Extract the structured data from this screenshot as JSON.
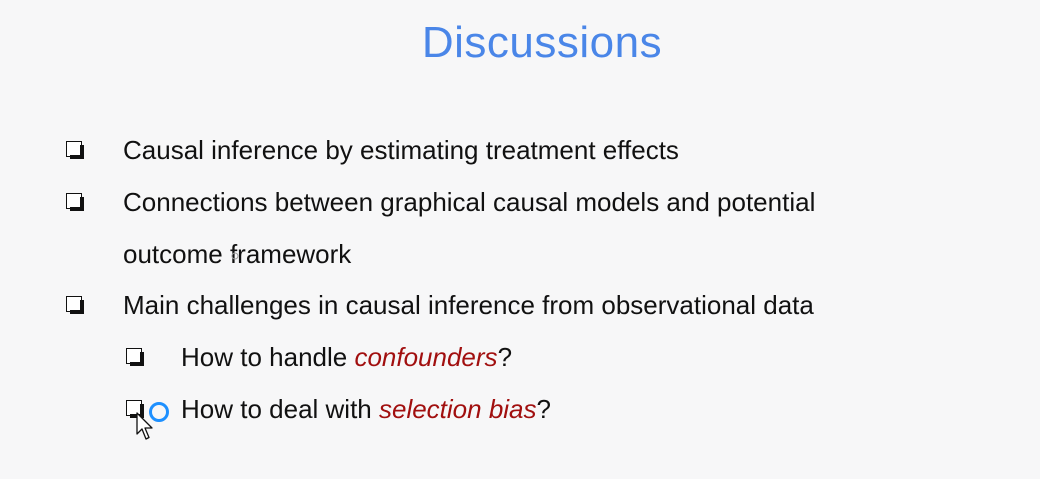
{
  "slide": {
    "title": "Discussions",
    "bullets": [
      {
        "level": 1,
        "parts": [
          {
            "text": "Causal inference by estimating treatment effects",
            "emphasis": false
          }
        ]
      },
      {
        "level": 1,
        "parts": [
          {
            "text": "Connections between graphical causal models and potential",
            "emphasis": false
          },
          {
            "text": "outcome framework",
            "emphasis": false
          }
        ]
      },
      {
        "level": 1,
        "parts": [
          {
            "text": "Main challenges in causal inference from observational data",
            "emphasis": false
          }
        ]
      },
      {
        "level": 2,
        "parts": [
          {
            "text": "How to handle ",
            "emphasis": false
          },
          {
            "text": "confounders",
            "emphasis": true
          },
          {
            "text": "?",
            "emphasis": false
          }
        ]
      },
      {
        "level": 2,
        "parts": [
          {
            "text": "How to deal with ",
            "emphasis": false
          },
          {
            "text": "selection bias",
            "emphasis": true
          },
          {
            "text": "?",
            "emphasis": false
          }
        ]
      }
    ]
  },
  "colors": {
    "title": "#4a86e8",
    "emphasis": "#a10f0f",
    "text": "#111111",
    "background": "#f7f7f8",
    "busy_ring": "#1e90ff"
  },
  "icons": {
    "bullet": "checkbox-shadow-icon",
    "cursor": "arrow-cursor-icon",
    "busy": "busy-ring-icon"
  }
}
